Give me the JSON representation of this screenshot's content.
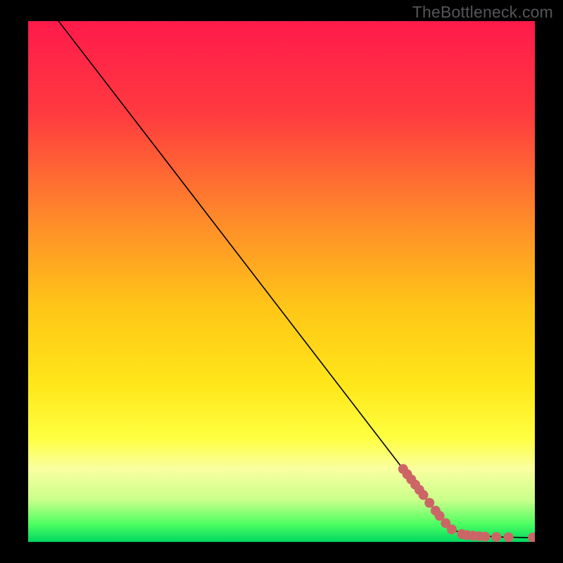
{
  "watermark": "TheBottleneck.com",
  "chart_data": {
    "type": "line",
    "title": "",
    "xlabel": "",
    "ylabel": "",
    "xlim": [
      0,
      100
    ],
    "ylim": [
      0,
      100
    ],
    "background_gradient": {
      "stops": [
        {
          "offset": 0.0,
          "color": "#ff1a4b"
        },
        {
          "offset": 0.18,
          "color": "#ff3b3f"
        },
        {
          "offset": 0.38,
          "color": "#ff8a2a"
        },
        {
          "offset": 0.55,
          "color": "#ffc617"
        },
        {
          "offset": 0.7,
          "color": "#ffe71a"
        },
        {
          "offset": 0.8,
          "color": "#ffff40"
        },
        {
          "offset": 0.86,
          "color": "#f9ffa0"
        },
        {
          "offset": 0.92,
          "color": "#c9ff8a"
        },
        {
          "offset": 0.965,
          "color": "#4fff62"
        },
        {
          "offset": 1.0,
          "color": "#00d860"
        }
      ]
    },
    "series": [
      {
        "name": "curve",
        "type": "line",
        "color": "#000000",
        "width": 1.6,
        "points": [
          {
            "x": 6.0,
            "y": 100.0
          },
          {
            "x": 25.0,
            "y": 76.0
          },
          {
            "x": 81.5,
            "y": 4.5
          },
          {
            "x": 84.0,
            "y": 2.2
          },
          {
            "x": 88.0,
            "y": 1.2
          },
          {
            "x": 94.0,
            "y": 0.9
          },
          {
            "x": 100.0,
            "y": 0.8
          }
        ]
      },
      {
        "name": "markers",
        "type": "scatter",
        "color": "#cc6666",
        "radius": 7,
        "points": [
          {
            "x": 74.0,
            "y": 14.0
          },
          {
            "x": 74.8,
            "y": 13.0
          },
          {
            "x": 75.6,
            "y": 12.0
          },
          {
            "x": 76.4,
            "y": 11.0
          },
          {
            "x": 77.2,
            "y": 10.0
          },
          {
            "x": 78.0,
            "y": 9.0
          },
          {
            "x": 79.2,
            "y": 7.5
          },
          {
            "x": 80.4,
            "y": 6.0
          },
          {
            "x": 81.2,
            "y": 5.0
          },
          {
            "x": 82.4,
            "y": 3.6
          },
          {
            "x": 83.6,
            "y": 2.4
          },
          {
            "x": 85.6,
            "y": 1.5
          },
          {
            "x": 86.6,
            "y": 1.3
          },
          {
            "x": 87.8,
            "y": 1.2
          },
          {
            "x": 89.0,
            "y": 1.1
          },
          {
            "x": 90.2,
            "y": 1.0
          },
          {
            "x": 92.4,
            "y": 0.95
          },
          {
            "x": 94.8,
            "y": 0.9
          },
          {
            "x": 99.6,
            "y": 0.85
          }
        ]
      }
    ]
  }
}
